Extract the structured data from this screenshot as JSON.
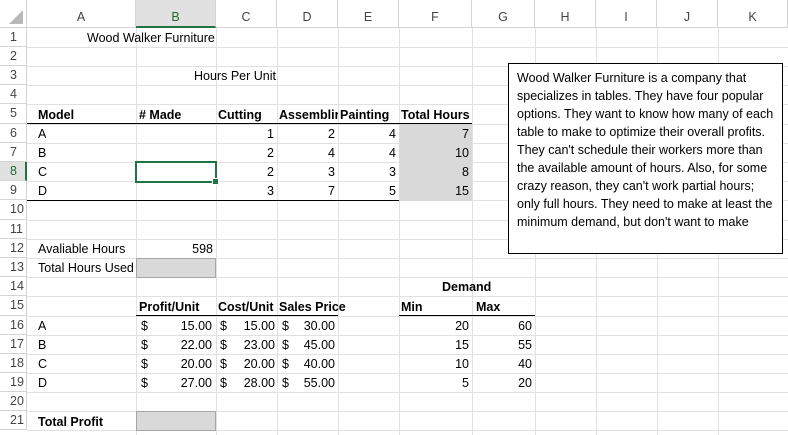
{
  "columns": [
    "A",
    "B",
    "C",
    "D",
    "E",
    "F",
    "G",
    "H",
    "I",
    "J",
    "K"
  ],
  "rows": [
    "1",
    "2",
    "3",
    "4",
    "5",
    "6",
    "7",
    "8",
    "9",
    "10",
    "11",
    "12",
    "13",
    "14",
    "15",
    "16",
    "17",
    "18",
    "19",
    "20",
    "21"
  ],
  "sheet": {
    "title": "Wood Walker Furniture",
    "hours_per_unit": "Hours Per Unit",
    "headers": {
      "model": "Model",
      "made": "# Made",
      "cutting": "Cutting",
      "assembly": "Assemblir",
      "painting": "Painting",
      "total": "Total Hours"
    },
    "products": [
      {
        "model": "A",
        "cutting": "1",
        "assembly": "2",
        "painting": "4",
        "total": "7"
      },
      {
        "model": "B",
        "cutting": "2",
        "assembly": "4",
        "painting": "4",
        "total": "10"
      },
      {
        "model": "C",
        "cutting": "2",
        "assembly": "3",
        "painting": "3",
        "total": "8"
      },
      {
        "model": "D",
        "cutting": "3",
        "assembly": "7",
        "painting": "5",
        "total": "15"
      }
    ],
    "available_label": "Avaliable Hours",
    "available_value": "598",
    "used_label": "Total Hours Used",
    "demand_label": "Demand",
    "profit_headers": {
      "profit": "Profit/Unit",
      "cost": "Cost/Unit",
      "price": "Sales Price",
      "min": "Min",
      "max": "Max"
    },
    "profits": [
      {
        "model": "A",
        "profit": "15.00",
        "cost": "15.00",
        "price": "30.00",
        "min": "20",
        "max": "60"
      },
      {
        "model": "B",
        "profit": "22.00",
        "cost": "23.00",
        "price": "45.00",
        "min": "15",
        "max": "55"
      },
      {
        "model": "C",
        "profit": "20.00",
        "cost": "20.00",
        "price": "40.00",
        "min": "10",
        "max": "40"
      },
      {
        "model": "D",
        "profit": "27.00",
        "cost": "28.00",
        "price": "55.00",
        "min": "5",
        "max": "20"
      }
    ],
    "currency": "$",
    "total_profit_label": "Total Profit"
  },
  "textbox": "Wood Walker Furniture is a company that specializes in tables. They have four popular options. They want to know how many of each table to make to optimize their overall profits. They can't schedule their workers more than the available amount of hours. Also, for some crazy reason, they can't work partial hours; only full hours. They need to make at least the minimum demand, but don't want to make",
  "selected_cell": "B8",
  "colors": {
    "selection": "#217346",
    "header_gray": "#e1e1e1",
    "fill_gray": "#d9d9d9"
  }
}
